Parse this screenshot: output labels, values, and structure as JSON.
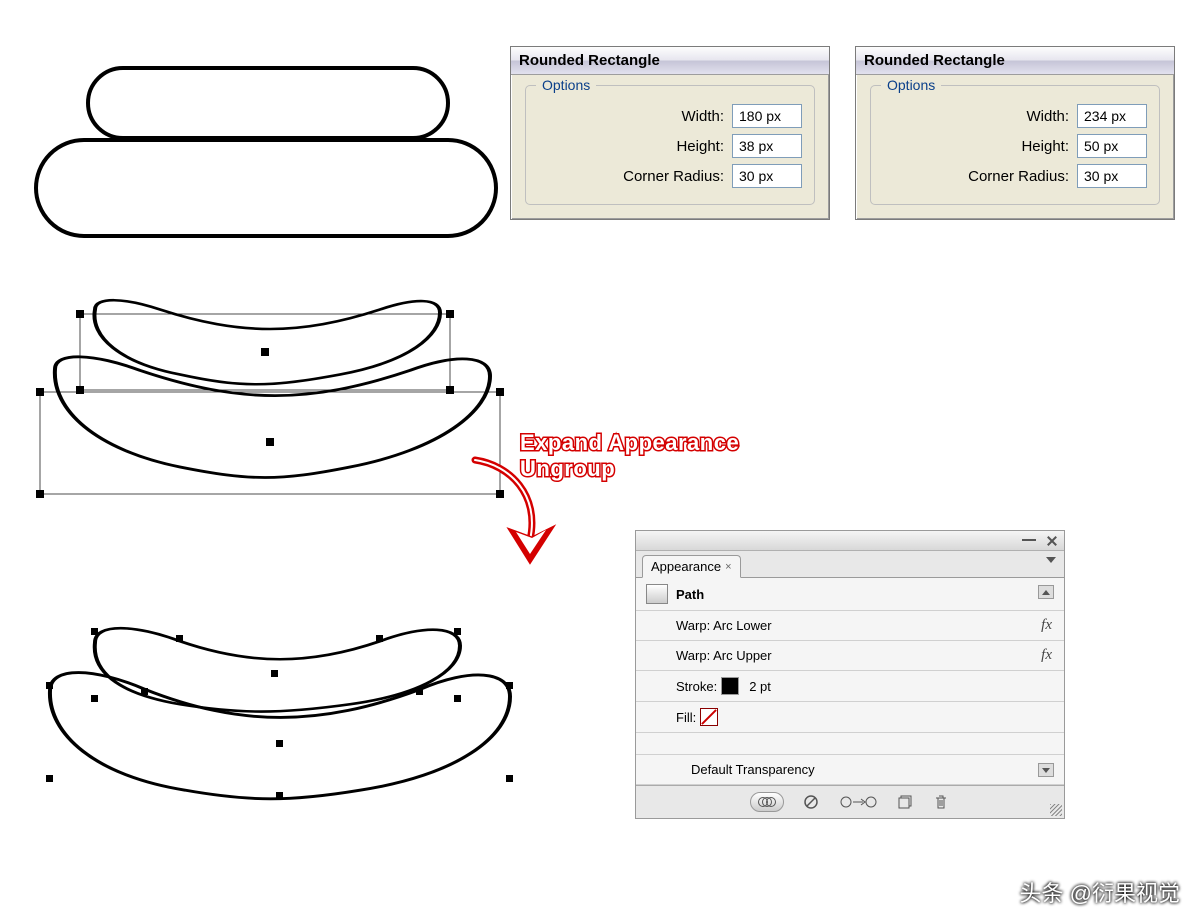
{
  "dialog1": {
    "title": "Rounded Rectangle",
    "legend": "Options",
    "width_label": "Width:",
    "height_label": "Height:",
    "radius_label": "Corner Radius:",
    "width": "180 px",
    "height": "38 px",
    "radius": "30 px"
  },
  "dialog2": {
    "title": "Rounded Rectangle",
    "legend": "Options",
    "width_label": "Width:",
    "height_label": "Height:",
    "radius_label": "Corner Radius:",
    "width": "234 px",
    "height": "50 px",
    "radius": "30 px"
  },
  "annotation": {
    "line1": "Expand Appearance",
    "line2": "Ungroup"
  },
  "appearance_panel": {
    "tab_label": "Appearance",
    "header": "Path",
    "items": [
      "Warp: Arc Lower",
      "Warp: Arc Upper"
    ],
    "stroke_label": "Stroke:",
    "stroke_value": "2 pt",
    "fill_label": "Fill:",
    "transparency_label": "Default Transparency"
  },
  "watermark": "头条 @衍果视觉"
}
